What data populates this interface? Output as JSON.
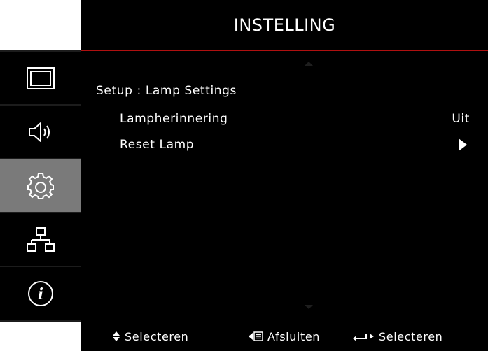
{
  "header": {
    "title": "INSTELLING"
  },
  "nav": {
    "items": [
      {
        "name": "display",
        "icon": "display-icon",
        "active": false
      },
      {
        "name": "audio",
        "icon": "speaker-icon",
        "active": false
      },
      {
        "name": "setup",
        "icon": "gear-icon",
        "active": true
      },
      {
        "name": "network",
        "icon": "network-icon",
        "active": false
      },
      {
        "name": "info",
        "icon": "info-icon",
        "active": false
      }
    ]
  },
  "content": {
    "breadcrumb": "Setup : Lamp Settings",
    "rows": [
      {
        "label": "Lampherinnering",
        "value": "Uit"
      },
      {
        "label": "Reset Lamp",
        "value_icon": "triangle-right-icon"
      }
    ]
  },
  "footer": {
    "hints": [
      {
        "icon": "up-down-arrows-icon",
        "label": "Selecteren"
      },
      {
        "icon": "left-menu-icon",
        "label": "Afsluiten"
      },
      {
        "icon": "enter-arrow-icon",
        "label": "Selecteren"
      }
    ]
  },
  "colors": {
    "accent_line": "#b01010",
    "active_nav": "#7a7a7a",
    "background": "#000000",
    "text": "#ffffff"
  }
}
